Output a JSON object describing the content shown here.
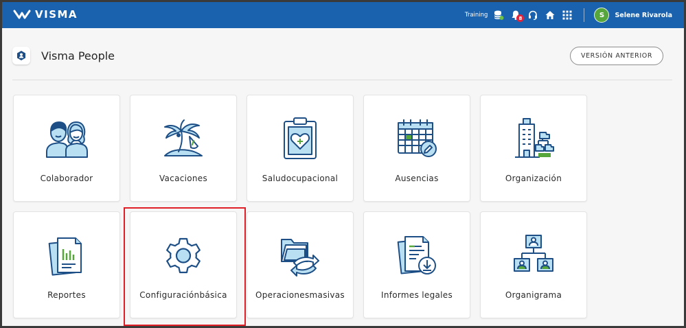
{
  "topbar": {
    "logo_text": "VISMA",
    "training_label": "Training",
    "notifications_count": "8",
    "user_initial": "S",
    "user_name": "Selene Rivarola"
  },
  "header": {
    "title": "Visma People",
    "previous_version_label": "VERSIÓN ANTERIOR"
  },
  "tiles": [
    {
      "id": "colaborador",
      "label": "Colaborador",
      "icon": "people-icon"
    },
    {
      "id": "vacaciones",
      "label": "Vacaciones",
      "icon": "palm-tree-icon"
    },
    {
      "id": "salud",
      "label_line1": "Salud",
      "label_line2": "ocupacional",
      "icon": "health-clipboard-icon"
    },
    {
      "id": "ausencias",
      "label": "Ausencias",
      "icon": "calendar-edit-icon"
    },
    {
      "id": "organizacion",
      "label": "Organización",
      "icon": "building-org-icon"
    },
    {
      "id": "reportes",
      "label": "Reportes",
      "icon": "report-icon"
    },
    {
      "id": "configuracion",
      "label_line1": "Configuración",
      "label_line2": "básica",
      "icon": "gear-icon"
    },
    {
      "id": "operaciones",
      "label_line1": "Operaciones",
      "label_line2": "masivas",
      "icon": "folder-sync-icon"
    },
    {
      "id": "informes",
      "label": "Informes legales",
      "icon": "document-download-icon"
    },
    {
      "id": "organigrama",
      "label": "Organigrama",
      "icon": "org-chart-icon"
    }
  ],
  "colors": {
    "topbar": "#1a62ad",
    "icon_dark": "#1d4f86",
    "icon_light": "#b9dff2",
    "accent_green": "#56a63c",
    "highlight": "#e01e26"
  }
}
